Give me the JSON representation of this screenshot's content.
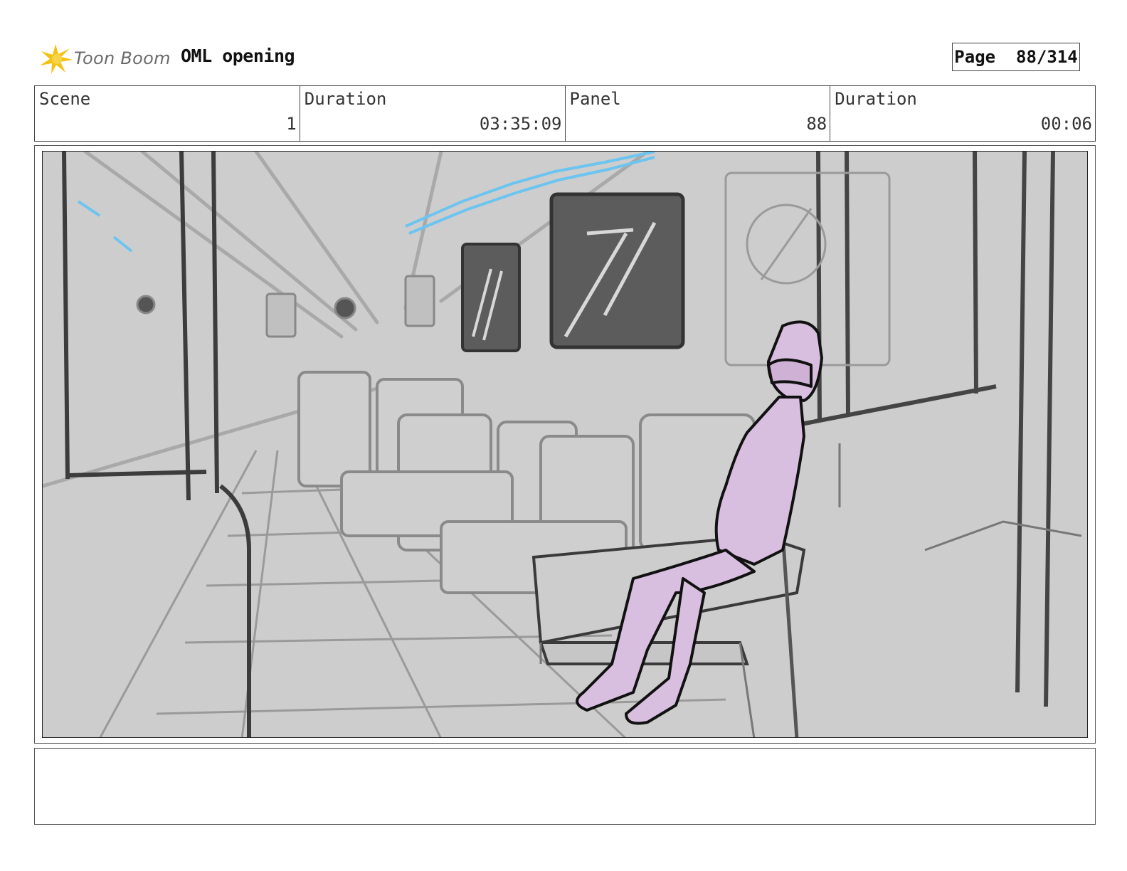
{
  "header": {
    "logo_text": "Toon Boom",
    "project_title": "OML opening",
    "page_label": "Page",
    "page_value": "88/314"
  },
  "info": {
    "scene_label": "Scene",
    "scene_value": "1",
    "duration_label": "Duration",
    "duration_value": "03:35:09",
    "panel_label": "Panel",
    "panel_value": "88",
    "panel_duration_label": "Duration",
    "panel_duration_value": "00:06"
  },
  "colors": {
    "logo_accent": "#f5c211",
    "panel_background": "#cdcdcd",
    "character_fill": "#d8bfdf",
    "window_fill": "#5c5c5c",
    "light_accent": "#6cc4f0"
  },
  "notes": ""
}
